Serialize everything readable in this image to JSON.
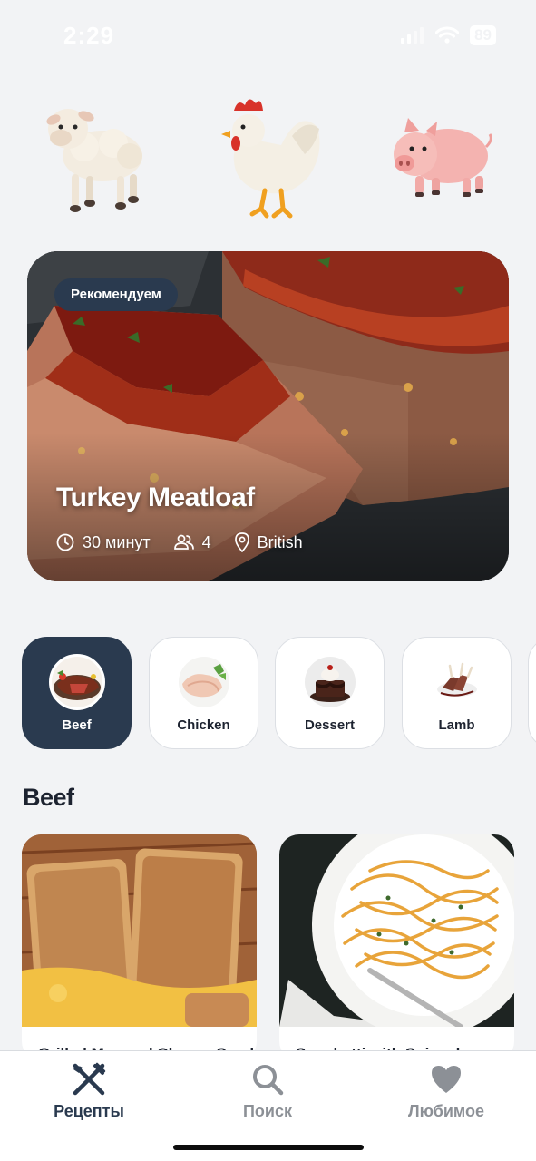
{
  "status": {
    "time": "2:29",
    "battery": "89"
  },
  "animals": [
    {
      "icon": "lamb-icon"
    },
    {
      "icon": "chicken-icon"
    },
    {
      "icon": "pig-icon"
    }
  ],
  "featured": {
    "badge": "Рекомендуем",
    "title": "Turkey Meatloaf",
    "time": "30 минут",
    "servings": "4",
    "cuisine": "British"
  },
  "categories": [
    {
      "label": "Beef",
      "active": true
    },
    {
      "label": "Chicken",
      "active": false
    },
    {
      "label": "Dessert",
      "active": false
    },
    {
      "label": "Lamb",
      "active": false
    }
  ],
  "section": {
    "title": "Beef"
  },
  "recipes": [
    {
      "name": "Grilled Mac and Cheese Sandwich"
    },
    {
      "name": "Spaghetti with Spinach"
    }
  ],
  "tabbar": {
    "items": [
      {
        "label": "Рецепты",
        "icon": "fork-knife-icon",
        "active": true
      },
      {
        "label": "Поиск",
        "icon": "search-icon",
        "active": false
      },
      {
        "label": "Любимое",
        "icon": "heart-icon",
        "active": false
      }
    ]
  },
  "colors": {
    "accent": "#2a3a4f",
    "background": "#f2f3f5",
    "inactive": "#8c9096"
  }
}
